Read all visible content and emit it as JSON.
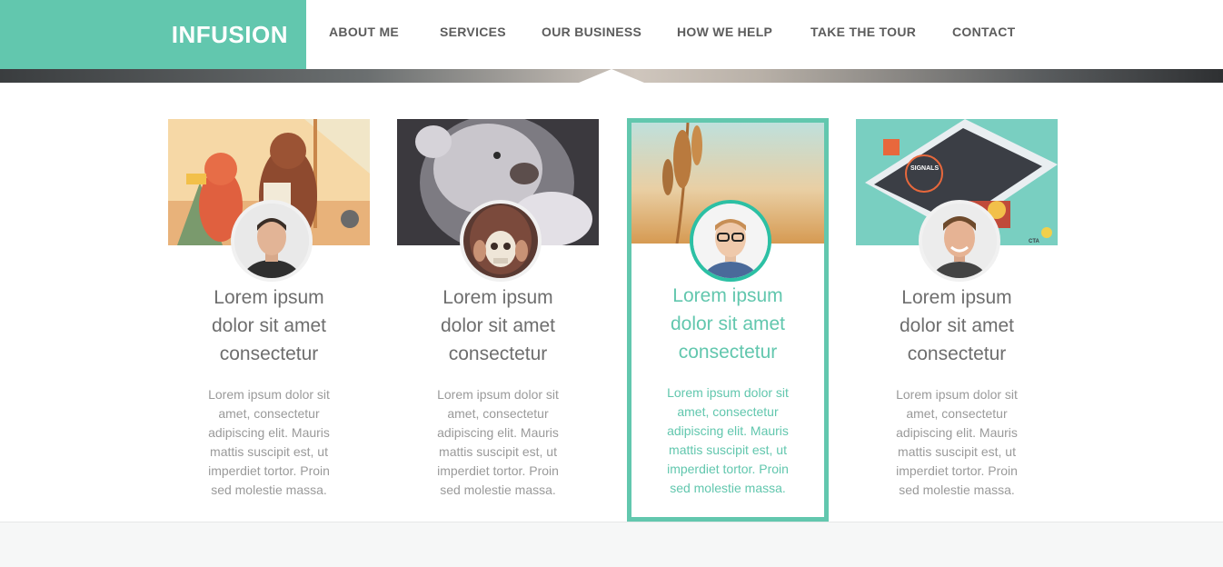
{
  "brand": {
    "name": "INFUSION"
  },
  "nav": {
    "items": [
      {
        "label": "ABOUT ME"
      },
      {
        "label": "SERVICES"
      },
      {
        "label": "OUR BUSINESS"
      },
      {
        "label": "HOW WE HELP"
      },
      {
        "label": "TAKE THE TOUR"
      },
      {
        "label": "CONTACT"
      }
    ]
  },
  "colors": {
    "accent": "#62c7ae",
    "text": "#6e6e6e",
    "muted": "#9a9a9a"
  },
  "cards": [
    {
      "image": "illustration-cat-and-bear",
      "avatar": "man-portrait-avatar",
      "title_lines": [
        "Lorem ipsum",
        "dolor sit amet",
        "consectetur"
      ],
      "text_lines": [
        "Lorem ipsum dolor sit",
        "amet, consectetur",
        "adipiscing elit. Mauris",
        "mattis suscipit est, ut",
        "imperdiet tortor. Proin",
        "sed molestie massa."
      ],
      "active": false
    },
    {
      "image": "white-bear-painting",
      "avatar": "skull-mask-avatar",
      "title_lines": [
        "Lorem ipsum",
        "dolor sit amet",
        "consectetur"
      ],
      "text_lines": [
        "Lorem ipsum dolor sit",
        "amet, consectetur",
        "adipiscing elit. Mauris",
        "mattis suscipit est, ut",
        "imperdiet tortor. Proin",
        "sed molestie massa."
      ],
      "active": false
    },
    {
      "image": "wheat-field-photo",
      "avatar": "man-glasses-avatar",
      "title_lines": [
        "Lorem ipsum",
        "dolor sit amet",
        "consectetur"
      ],
      "text_lines": [
        "Lorem ipsum dolor sit",
        "amet, consectetur",
        "adipiscing elit. Mauris",
        "mattis suscipit est, ut",
        "imperdiet tortor. Proin",
        "sed molestie massa."
      ],
      "active": true
    },
    {
      "image": "phone-signals-infographic",
      "image_labels": [
        "SIGNALS",
        "CTA"
      ],
      "avatar": "smiling-man-avatar",
      "title_lines": [
        "Lorem ipsum",
        "dolor sit amet",
        "consectetur"
      ],
      "text_lines": [
        "Lorem ipsum dolor sit",
        "amet, consectetur",
        "adipiscing elit. Mauris",
        "mattis suscipit est, ut",
        "imperdiet tortor. Proin",
        "sed molestie massa."
      ],
      "active": false
    }
  ]
}
